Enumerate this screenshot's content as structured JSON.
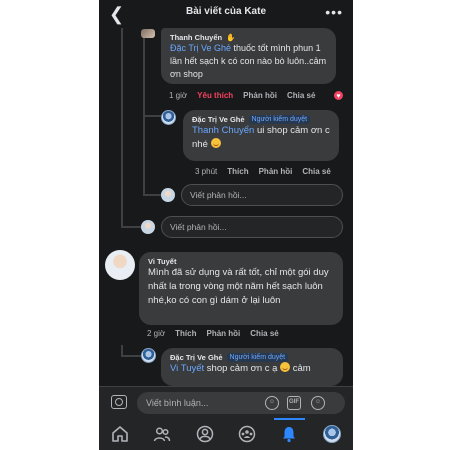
{
  "header": {
    "back_icon": "chevron-left-icon",
    "title": "Bài viết của Kate",
    "more_icon": "more-horizontal-icon"
  },
  "comment_thanh": {
    "author": "Thanh Chuyển",
    "mention": "Đặc Trị Ve Ghẻ",
    "text": " thuốc tốt mình phun 1 lần hết sạch k có con nào bò luôn..cảm ơn shop",
    "time": "1 giờ",
    "like_label": "Yêu thích",
    "reply_label": "Phản hồi",
    "share_label": "Chia sẻ",
    "reaction_icon": "heart-icon"
  },
  "reply_shop_1": {
    "author": "Đặc Trị Ve Ghẻ",
    "badge": "Người kiểm duyệt",
    "mention": "Thanh Chuyển",
    "text": " ui shop cảm ơn c nhé",
    "time": "3 phút",
    "like_label": "Thích",
    "reply_label": "Phản hồi",
    "share_label": "Chia sẻ"
  },
  "reply_box_1": {
    "placeholder": "Viết phản hồi..."
  },
  "reply_box_2": {
    "placeholder": "Viết phản hồi..."
  },
  "comment_vi": {
    "author": "Vi Tuyết",
    "text": "Mình đã sử dụng và rất tốt, chỉ một gói duy nhất la trong vòng một năm hết sạch luôn nhé,ko có con gì dám ở lại luôn",
    "time": "2 giờ",
    "like_label": "Thích",
    "reply_label": "Phản hồi",
    "share_label": "Chia sẻ"
  },
  "reply_shop_2": {
    "author": "Đặc Trị Ve Ghẻ",
    "badge": "Người kiểm duyệt",
    "mention": "Vi Tuyết",
    "text": " shop cảm ơn c ạ",
    "text_tail": " cảm"
  },
  "composer": {
    "placeholder": "Viết bình luận...",
    "gif_label": "GIF"
  },
  "tabbar": {
    "items": [
      "home-icon",
      "friends-icon",
      "profile-icon",
      "groups-icon",
      "notifications-icon",
      "menu-avatar-icon"
    ],
    "active": "notifications-icon"
  },
  "colors": {
    "background": "#18191a",
    "bubble": "#3a3b3c",
    "accent": "#2d88ff",
    "mention": "#6aa7ff",
    "love": "#f3425f"
  }
}
